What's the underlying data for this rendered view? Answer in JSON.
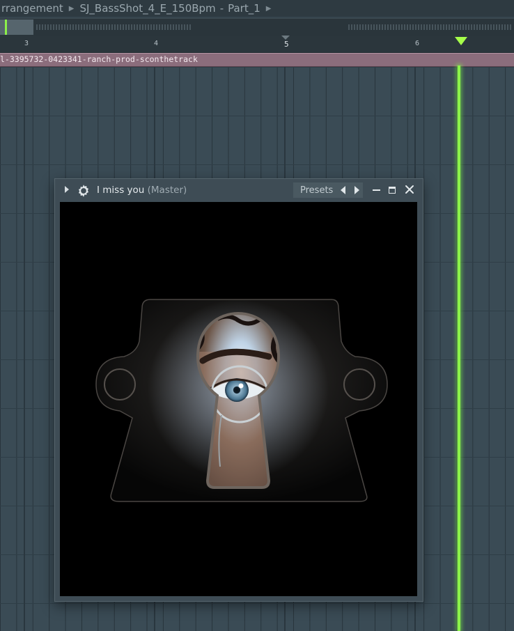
{
  "breadcrumb": {
    "items": [
      "rrangement",
      "SJ_BassShot_4_E_150Bpm",
      "-",
      "Part_1"
    ]
  },
  "ruler": {
    "ticks": [
      "3",
      "4",
      "5",
      "6"
    ]
  },
  "playlist": {
    "clip_name": "l-3395732-0423341-ranch-prod-sconthetrack"
  },
  "plugin": {
    "title": "I miss you",
    "subtitle": "(Master)",
    "presets_label": "Presets"
  },
  "colors": {
    "playhead": "#8cf44a",
    "clip": "#8b6d7c",
    "grid": "#3a4b55"
  },
  "icons": [
    "chevron-right-icon",
    "gear-icon",
    "prev-arrow-icon",
    "next-arrow-icon",
    "minimize-icon",
    "maximize-icon",
    "close-icon"
  ]
}
